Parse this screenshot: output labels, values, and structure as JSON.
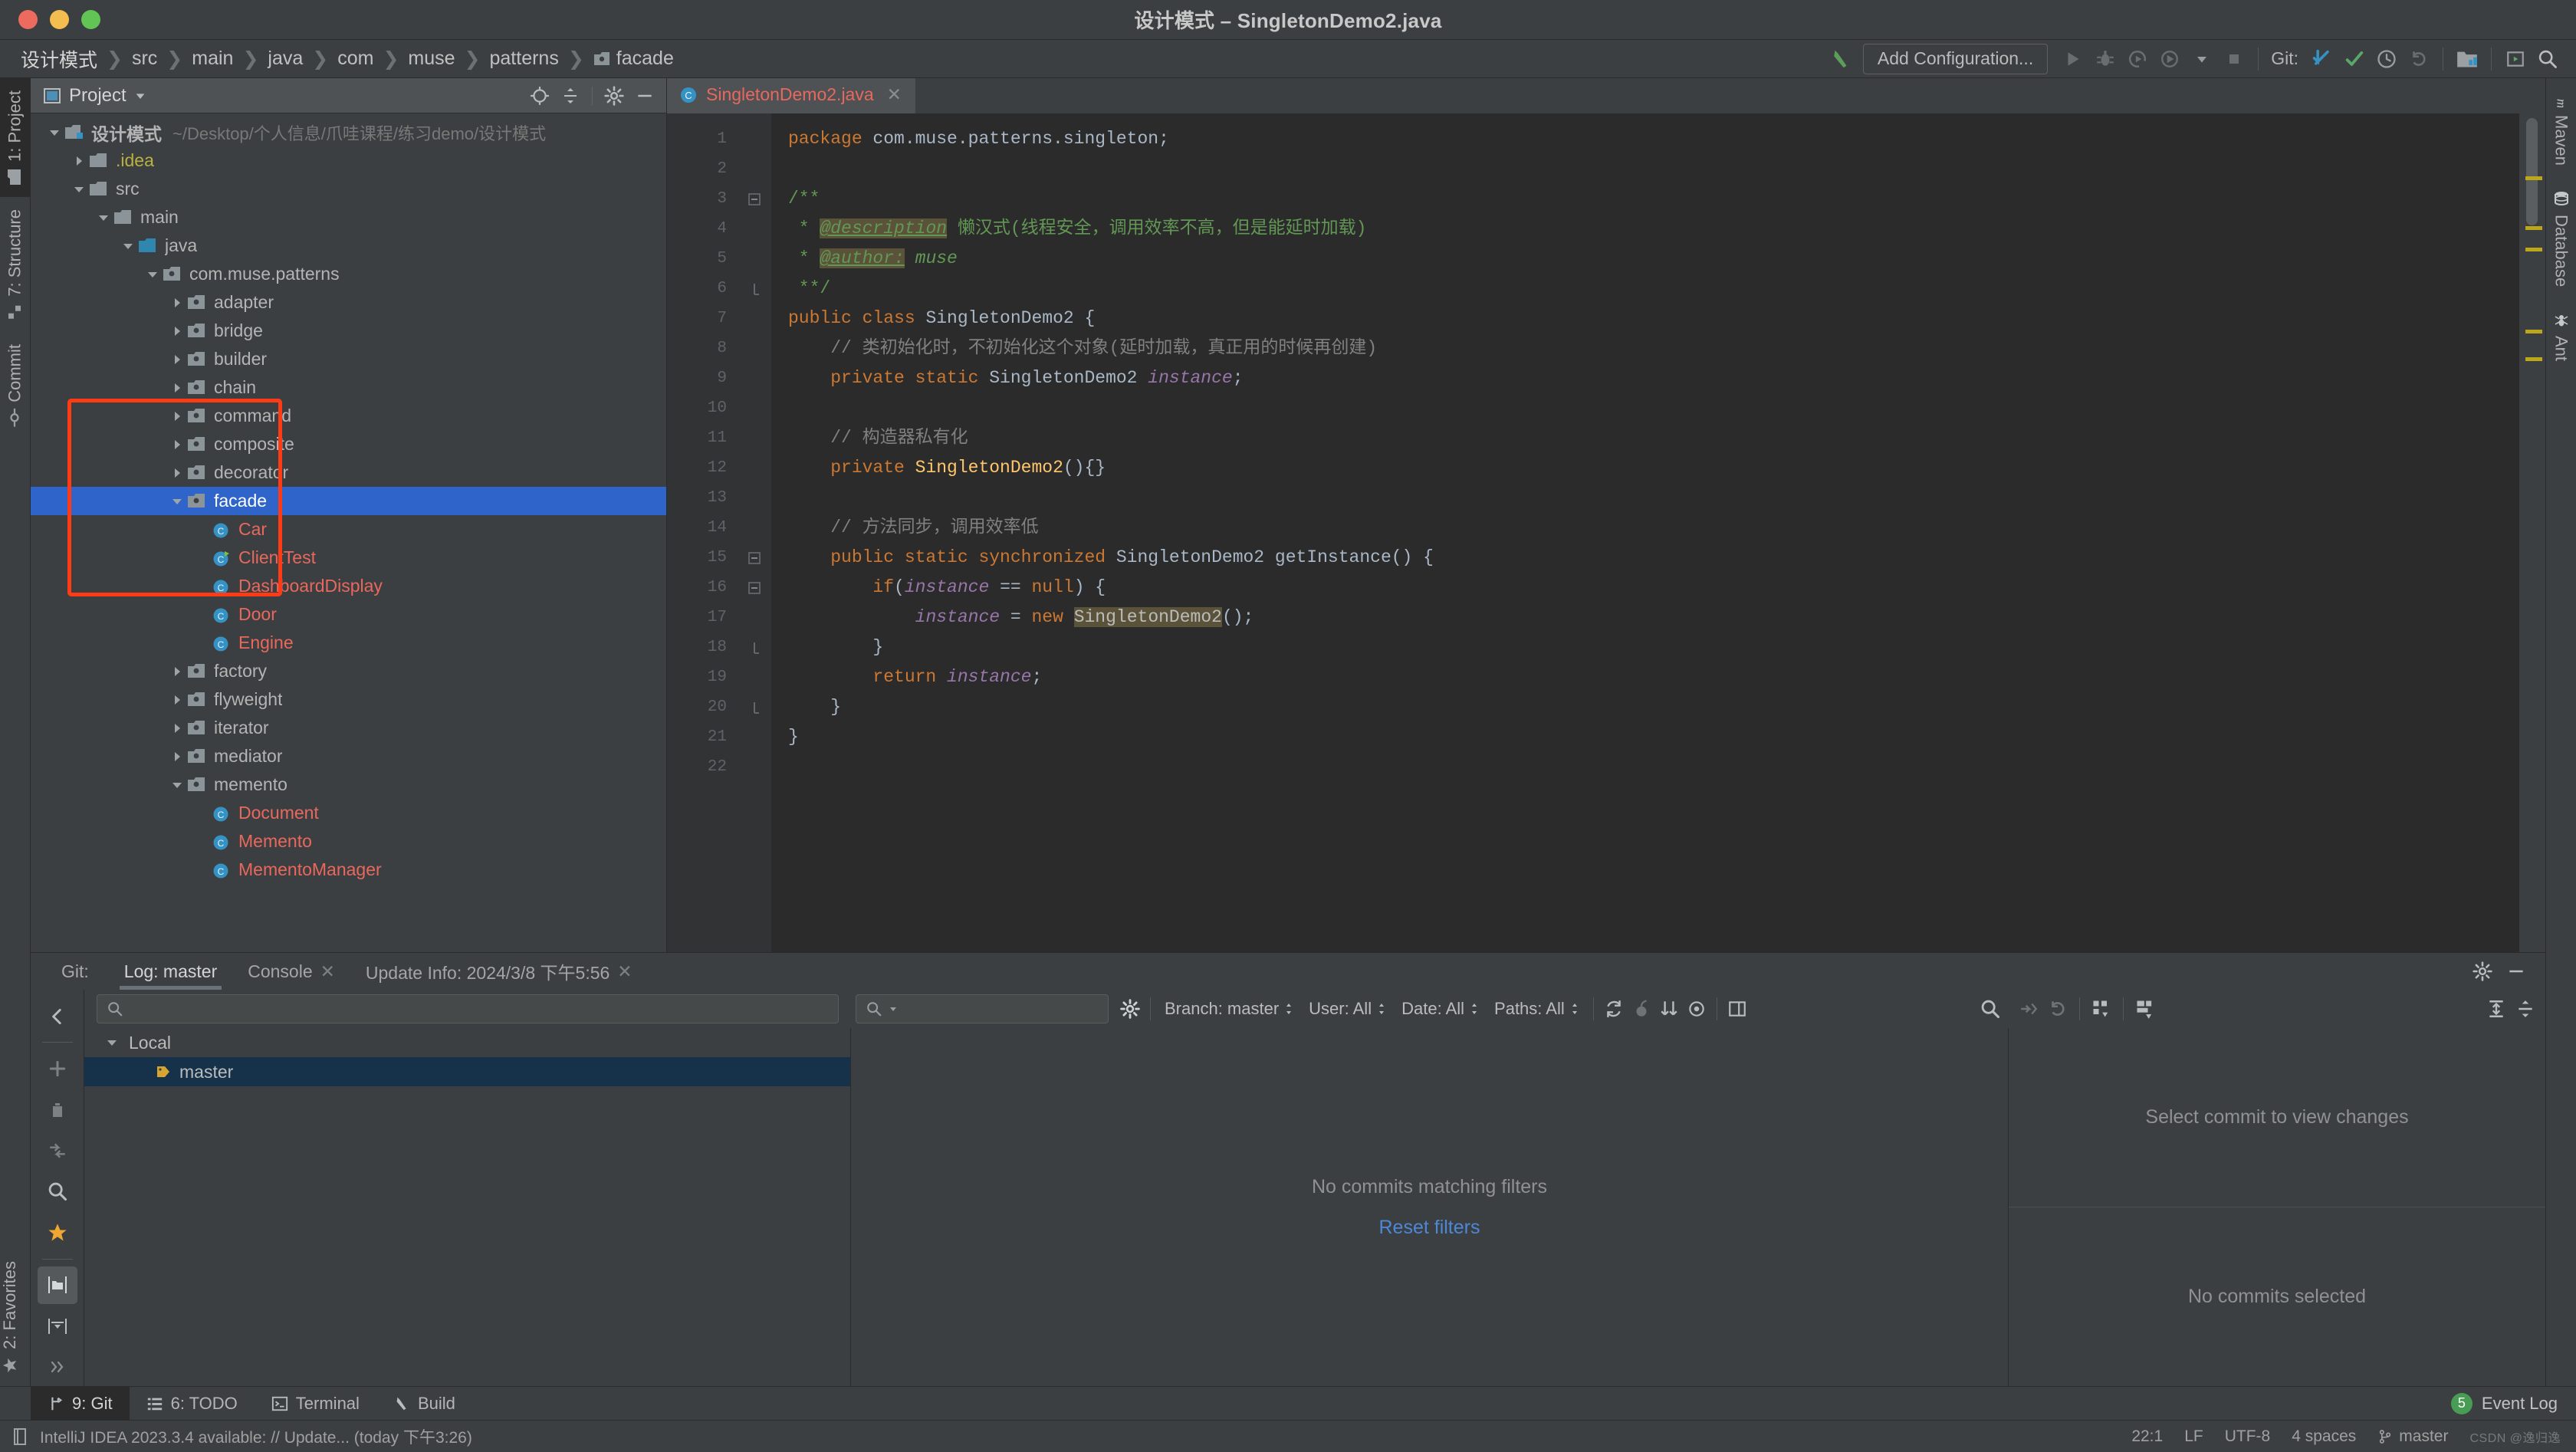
{
  "window": {
    "title": "设计模式 – SingletonDemo2.java",
    "traffic_lights": [
      "close-red",
      "minimize-yellow",
      "maximize-green"
    ]
  },
  "navbar": {
    "breadcrumbs": [
      "设计模式",
      "src",
      "main",
      "java",
      "com",
      "muse",
      "patterns",
      "facade"
    ],
    "separator": "❯",
    "run_config_label": "Add Configuration...",
    "git_label": "Git:",
    "icons": [
      "build-hammer-icon",
      "run-icon",
      "debug-icon",
      "run-with-coverage-icon",
      "profile-icon",
      "chevron-down-icon",
      "stop-icon",
      "update-project-icon",
      "commit-icon",
      "history-icon",
      "rollback-icon",
      "project-structure-icon",
      "new-ui-icon",
      "search-everywhere-icon"
    ]
  },
  "left_strip": {
    "tabs": [
      {
        "label": "1: Project",
        "icon": "project-folder-icon",
        "active": true
      },
      {
        "label": "7: Structure",
        "icon": "structure-icon",
        "active": false
      },
      {
        "label": "Commit",
        "icon": "commit-circle-icon",
        "active": false
      }
    ],
    "bottom_tabs": [
      {
        "label": "2: Favorites",
        "icon": "star-icon",
        "active": false
      }
    ]
  },
  "right_strip": {
    "tabs": [
      {
        "label": "Maven",
        "icon": "maven-icon"
      },
      {
        "label": "Database",
        "icon": "database-icon"
      },
      {
        "label": "Ant",
        "icon": "ant-icon"
      }
    ]
  },
  "project_panel": {
    "title": "Project",
    "dropdown_icon": "chevron-down-icon",
    "toolbar_icons": [
      "locate-icon",
      "collapse-all-icon",
      "gear-icon",
      "hide-icon"
    ],
    "root": {
      "label": "设计模式",
      "path": "~/Desktop/个人信息/爪哇课程/练习demo/设计模式"
    },
    "tree": [
      {
        "label": "设计模式",
        "path": "~/Desktop/个人信息/爪哇课程/练习demo/设计模式",
        "depth": 0,
        "arrow": "down",
        "icon": "module-folder-icon",
        "type": "root"
      },
      {
        "label": ".idea",
        "depth": 1,
        "arrow": "right",
        "icon": "folder-icon",
        "type": "idea"
      },
      {
        "label": "src",
        "depth": 1,
        "arrow": "down",
        "icon": "folder-icon",
        "type": "folder"
      },
      {
        "label": "main",
        "depth": 2,
        "arrow": "down",
        "icon": "folder-icon",
        "type": "folder"
      },
      {
        "label": "java",
        "depth": 3,
        "arrow": "down",
        "icon": "source-folder-icon",
        "type": "folder"
      },
      {
        "label": "com.muse.patterns",
        "depth": 4,
        "arrow": "down",
        "icon": "package-icon",
        "type": "folder"
      },
      {
        "label": "adapter",
        "depth": 5,
        "arrow": "right",
        "icon": "package-icon",
        "type": "folder"
      },
      {
        "label": "bridge",
        "depth": 5,
        "arrow": "right",
        "icon": "package-icon",
        "type": "folder"
      },
      {
        "label": "builder",
        "depth": 5,
        "arrow": "right",
        "icon": "package-icon",
        "type": "folder"
      },
      {
        "label": "chain",
        "depth": 5,
        "arrow": "right",
        "icon": "package-icon",
        "type": "folder"
      },
      {
        "label": "command",
        "depth": 5,
        "arrow": "right",
        "icon": "package-icon",
        "type": "folder"
      },
      {
        "label": "composite",
        "depth": 5,
        "arrow": "right",
        "icon": "package-icon",
        "type": "folder"
      },
      {
        "label": "decorator",
        "depth": 5,
        "arrow": "right",
        "icon": "package-icon",
        "type": "folder"
      },
      {
        "label": "facade",
        "depth": 5,
        "arrow": "down",
        "icon": "package-icon",
        "type": "folder",
        "selected": true
      },
      {
        "label": "Car",
        "depth": 6,
        "arrow": "none",
        "icon": "java-class-icon",
        "type": "java"
      },
      {
        "label": "ClientTest",
        "depth": 6,
        "arrow": "none",
        "icon": "java-class-runnable-icon",
        "type": "java"
      },
      {
        "label": "DashboardDisplay",
        "depth": 6,
        "arrow": "none",
        "icon": "java-class-icon",
        "type": "java"
      },
      {
        "label": "Door",
        "depth": 6,
        "arrow": "none",
        "icon": "java-class-icon",
        "type": "java"
      },
      {
        "label": "Engine",
        "depth": 6,
        "arrow": "none",
        "icon": "java-class-icon",
        "type": "java"
      },
      {
        "label": "factory",
        "depth": 5,
        "arrow": "right",
        "icon": "package-icon",
        "type": "folder"
      },
      {
        "label": "flyweight",
        "depth": 5,
        "arrow": "right",
        "icon": "package-icon",
        "type": "folder"
      },
      {
        "label": "iterator",
        "depth": 5,
        "arrow": "right",
        "icon": "package-icon",
        "type": "folder"
      },
      {
        "label": "mediator",
        "depth": 5,
        "arrow": "right",
        "icon": "package-icon",
        "type": "folder"
      },
      {
        "label": "memento",
        "depth": 5,
        "arrow": "down",
        "icon": "package-icon",
        "type": "folder"
      },
      {
        "label": "Document",
        "depth": 6,
        "arrow": "none",
        "icon": "java-class-icon",
        "type": "java"
      },
      {
        "label": "Memento",
        "depth": 6,
        "arrow": "none",
        "icon": "java-class-icon",
        "type": "java"
      },
      {
        "label": "MementoManager",
        "depth": 6,
        "arrow": "none",
        "icon": "java-class-icon",
        "type": "java"
      }
    ]
  },
  "editor": {
    "tab": {
      "label": "SingletonDemo2.java",
      "icon": "java-class-icon",
      "close_icon": "close-icon"
    },
    "total_lines": 22,
    "lines": [
      {
        "n": 1,
        "fold": "",
        "tokens": [
          {
            "t": "package ",
            "c": "k"
          },
          {
            "t": "com.muse.patterns.singleton;",
            "c": "pun"
          }
        ]
      },
      {
        "n": 2,
        "fold": "",
        "tokens": []
      },
      {
        "n": 3,
        "fold": "minus",
        "tokens": [
          {
            "t": "/**",
            "c": "doc"
          }
        ]
      },
      {
        "n": 4,
        "fold": "",
        "tokens": [
          {
            "t": " * ",
            "c": "doc"
          },
          {
            "t": "@description",
            "c": "doctag"
          },
          {
            "t": " 懒汉式(线程安全，调用效率不高，但是能延时加载)",
            "c": "doc"
          }
        ]
      },
      {
        "n": 5,
        "fold": "",
        "tokens": [
          {
            "t": " * ",
            "c": "doc"
          },
          {
            "t": "@author:",
            "c": "doctag"
          },
          {
            "t": " muse",
            "c": "docit"
          }
        ]
      },
      {
        "n": 6,
        "fold": "end",
        "tokens": [
          {
            "t": " **/",
            "c": "doc"
          }
        ]
      },
      {
        "n": 7,
        "fold": "",
        "tokens": [
          {
            "t": "public class ",
            "c": "k"
          },
          {
            "t": "SingletonDemo2 ",
            "c": "cls"
          },
          {
            "t": "{",
            "c": "pun"
          }
        ]
      },
      {
        "n": 8,
        "fold": "",
        "tokens": [
          {
            "t": "    // 类初始化时，不初始化这个对象(延时加载，真正用的时候再创建)",
            "c": "cmt"
          }
        ]
      },
      {
        "n": 9,
        "fold": "",
        "tokens": [
          {
            "t": "    private static ",
            "c": "k"
          },
          {
            "t": "SingletonDemo2 ",
            "c": "cls"
          },
          {
            "t": "instance",
            "c": "fld"
          },
          {
            "t": ";",
            "c": "pun"
          }
        ]
      },
      {
        "n": 10,
        "fold": "",
        "tokens": []
      },
      {
        "n": 11,
        "fold": "",
        "tokens": [
          {
            "t": "    // 构造器私有化",
            "c": "cmt"
          }
        ]
      },
      {
        "n": 12,
        "fold": "",
        "tokens": [
          {
            "t": "    private ",
            "c": "k"
          },
          {
            "t": "SingletonDemo2",
            "c": "mth"
          },
          {
            "t": "(){}",
            "c": "pun"
          }
        ]
      },
      {
        "n": 13,
        "fold": "",
        "tokens": []
      },
      {
        "n": 14,
        "fold": "",
        "tokens": [
          {
            "t": "    // 方法同步，调用效率低",
            "c": "cmt"
          }
        ]
      },
      {
        "n": 15,
        "fold": "minus",
        "tokens": [
          {
            "t": "    public static synchronized ",
            "c": "k"
          },
          {
            "t": "SingletonDemo2 ",
            "c": "cls"
          },
          {
            "t": "getInstance",
            "c": "cls"
          },
          {
            "t": "() {",
            "c": "pun"
          }
        ]
      },
      {
        "n": 16,
        "fold": "minus",
        "tokens": [
          {
            "t": "        ",
            "c": "pun"
          },
          {
            "t": "if",
            "c": "k"
          },
          {
            "t": "(",
            "c": "pun"
          },
          {
            "t": "instance",
            "c": "fld"
          },
          {
            "t": " == ",
            "c": "pun"
          },
          {
            "t": "null",
            "c": "k"
          },
          {
            "t": ") {",
            "c": "pun"
          }
        ]
      },
      {
        "n": 17,
        "fold": "",
        "tokens": [
          {
            "t": "            ",
            "c": "pun"
          },
          {
            "t": "instance",
            "c": "fld"
          },
          {
            "t": " = ",
            "c": "pun"
          },
          {
            "t": "new ",
            "c": "k"
          },
          {
            "t": "SingletonDemo2",
            "c": "hl"
          },
          {
            "t": "();",
            "c": "pun"
          }
        ]
      },
      {
        "n": 18,
        "fold": "end",
        "tokens": [
          {
            "t": "        }",
            "c": "pun"
          }
        ]
      },
      {
        "n": 19,
        "fold": "",
        "tokens": [
          {
            "t": "        ",
            "c": "pun"
          },
          {
            "t": "return ",
            "c": "k"
          },
          {
            "t": "instance",
            "c": "fld"
          },
          {
            "t": ";",
            "c": "pun"
          }
        ]
      },
      {
        "n": 20,
        "fold": "end",
        "tokens": [
          {
            "t": "    }",
            "c": "pun"
          }
        ]
      },
      {
        "n": 21,
        "fold": "",
        "tokens": [
          {
            "t": "}",
            "c": "pun"
          }
        ]
      },
      {
        "n": 22,
        "fold": "",
        "tokens": []
      }
    ]
  },
  "git_panel": {
    "label": "Git:",
    "tabs": [
      {
        "label": "Log: master",
        "active": true,
        "closeable": false
      },
      {
        "label": "Console",
        "active": false,
        "closeable": true
      },
      {
        "label": "Update Info: 2024/3/8 下午5:56",
        "active": false,
        "closeable": true
      }
    ],
    "header_icons": [
      "gear-icon",
      "hide-icon"
    ],
    "side_toolbar_icons": [
      "back-icon",
      "add-icon",
      "delete-icon",
      "merge-icon",
      "search-icon",
      "favorite-star-icon",
      "show-folders-icon",
      "collapse-icon",
      "expand-more-icon"
    ],
    "branch_search_placeholder": "",
    "branch_tree": [
      {
        "label": "Local",
        "depth": 0,
        "arrow": "down",
        "type": "group"
      },
      {
        "label": "master",
        "depth": 1,
        "arrow": "none",
        "type": "branch",
        "selected": true,
        "icon": "branch-tag-icon"
      }
    ],
    "log_toolbar": {
      "search_placeholder": "",
      "search_icon": "search-icon",
      "gear_icon": "gear-icon",
      "filters": [
        {
          "label": "Branch: master"
        },
        {
          "label": "User: All"
        },
        {
          "label": "Date: All"
        },
        {
          "label": "Paths: All"
        }
      ],
      "icons": [
        "refresh-icon",
        "cherry-pick-icon",
        "sort-icon",
        "eye-icon",
        "show-details-icon",
        "text-search-icon"
      ]
    },
    "log_empty": {
      "message": "No commits matching filters",
      "action": "Reset filters"
    },
    "details": {
      "toolbar_icons": [
        "cherry-pick-icon",
        "revert-icon",
        "group-icon",
        "layout-icon",
        "expand-all-icon",
        "collapse-all-icon"
      ],
      "top_message": "Select commit to view changes",
      "bottom_message": "No commits selected"
    }
  },
  "bottom_bar": {
    "tools": [
      {
        "label": "9: Git",
        "accel": "9",
        "icon": "git-branch-icon",
        "active": true
      },
      {
        "label": "6: TODO",
        "accel": "6",
        "icon": "todo-list-icon",
        "active": false
      },
      {
        "label": "Terminal",
        "icon": "terminal-icon",
        "active": false
      },
      {
        "label": "Build",
        "icon": "build-hammer-icon",
        "active": false
      }
    ],
    "event_log": {
      "label": "Event Log",
      "count": "5",
      "badge_color": "#499c54"
    }
  },
  "status_bar": {
    "message": "IntelliJ IDEA 2023.3.4 available: // Update... (today 下午3:26)",
    "message_icon": "notification-icon",
    "caret": "22:1",
    "line_separator": "LF",
    "encoding": "UTF-8",
    "indent": "4 spaces",
    "branch": "master",
    "branch_icon": "git-branch-icon",
    "watermark": "CSDN @逸归逸"
  }
}
